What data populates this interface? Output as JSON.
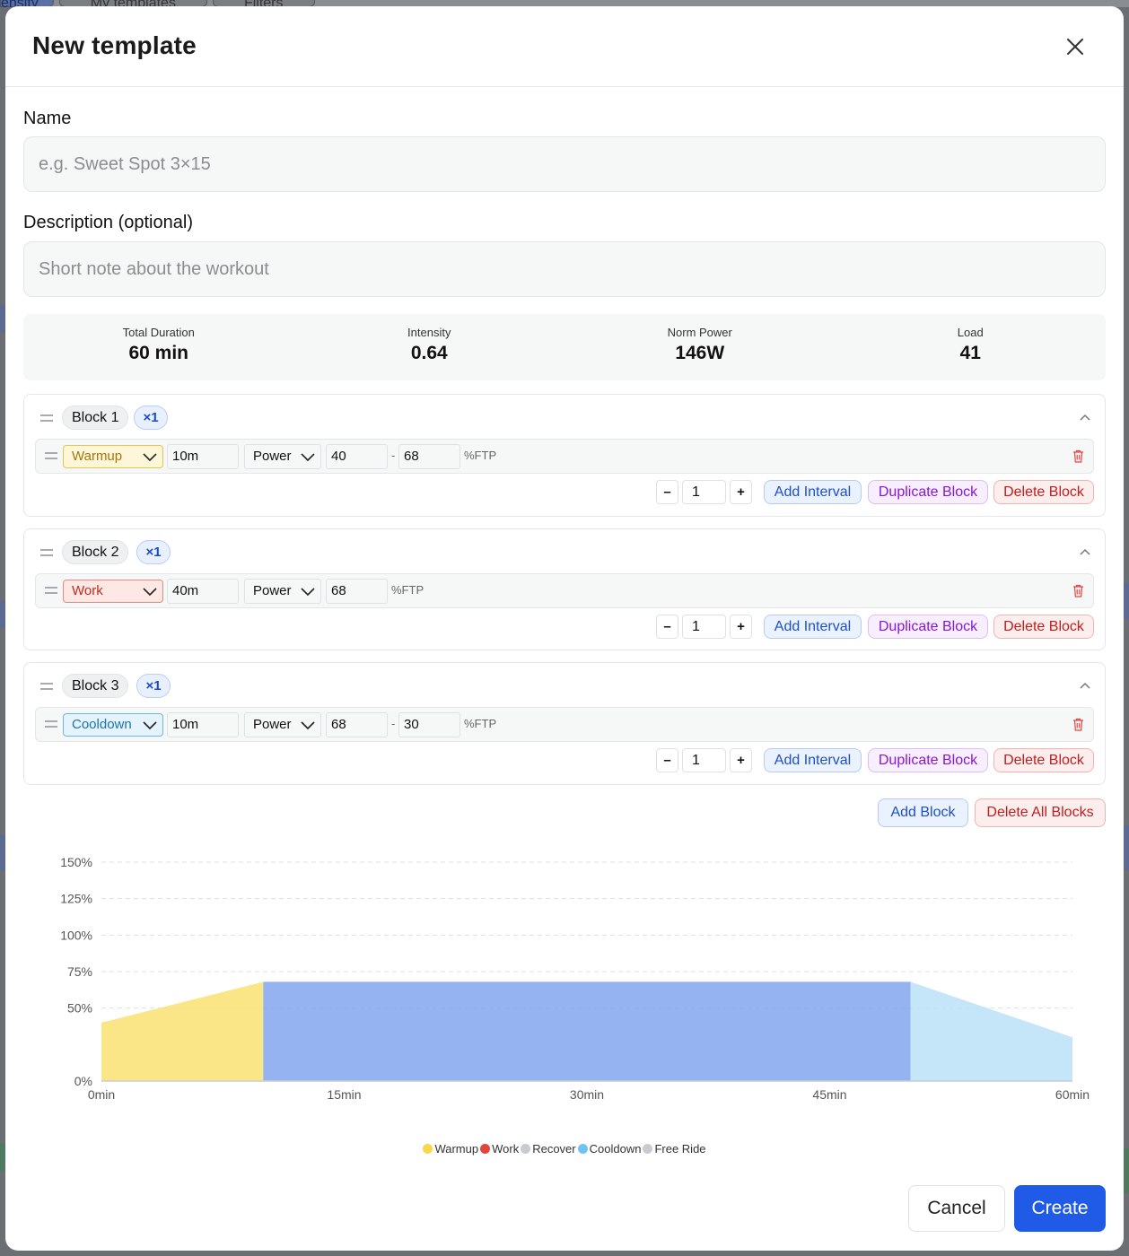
{
  "background": {
    "tabs": [
      "ensity",
      "My templates",
      "Filters"
    ]
  },
  "modal": {
    "title": "New template",
    "name_label": "Name",
    "name_placeholder": "e.g. Sweet Spot 3×15",
    "description_label": "Description (optional)",
    "description_placeholder": "Short note about the workout"
  },
  "stats": [
    {
      "label": "Total Duration",
      "value": "60 min"
    },
    {
      "label": "Intensity",
      "value": "0.64"
    },
    {
      "label": "Norm Power",
      "value": "146W"
    },
    {
      "label": "Load",
      "value": "41"
    }
  ],
  "blocks": [
    {
      "name": "Block 1",
      "repeat": "×1",
      "interval": {
        "type": "Warmup",
        "duration": "10m",
        "target": "Power",
        "from": "40",
        "to": "68",
        "unit": "%FTP"
      },
      "count": "1"
    },
    {
      "name": "Block 2",
      "repeat": "×1",
      "interval": {
        "type": "Work",
        "duration": "40m",
        "target": "Power",
        "from": "68",
        "unit": "%FTP"
      },
      "count": "1"
    },
    {
      "name": "Block 3",
      "repeat": "×1",
      "interval": {
        "type": "Cooldown",
        "duration": "10m",
        "target": "Power",
        "from": "68",
        "to": "30",
        "unit": "%FTP"
      },
      "count": "1"
    }
  ],
  "block_actions": {
    "minus": "–",
    "plus": "+",
    "range_dash": "-",
    "add_interval": "Add Interval",
    "duplicate_block": "Duplicate Block",
    "delete_block": "Delete Block"
  },
  "global_actions": {
    "add_block": "Add Block",
    "delete_all_blocks": "Delete All Blocks"
  },
  "chart_data": {
    "type": "area",
    "x_unit": "min",
    "xlim": [
      0,
      60
    ],
    "ylim": [
      0,
      150
    ],
    "yticks": [
      "0%",
      "50%",
      "75%",
      "100%",
      "125%",
      "150%"
    ],
    "ytick_values": [
      0,
      50,
      75,
      100,
      125,
      150
    ],
    "xticks": [
      "0min",
      "15min",
      "30min",
      "45min",
      "60min"
    ],
    "xtick_values": [
      0,
      15,
      30,
      45,
      60
    ],
    "grid": true,
    "segments": [
      {
        "type": "Warmup",
        "start": 0,
        "end": 10,
        "from": 40,
        "to": 68,
        "color": "#f9e27a"
      },
      {
        "type": "Work",
        "start": 10,
        "end": 50,
        "from": 68,
        "to": 68,
        "color": "#8aaaf0"
      },
      {
        "type": "Cooldown",
        "start": 50,
        "end": 60,
        "from": 68,
        "to": 30,
        "color": "#bfe2f8"
      }
    ],
    "legend": [
      {
        "name": "Warmup",
        "color": "#f7d84a"
      },
      {
        "name": "Work",
        "color": "#e2463a"
      },
      {
        "name": "Recover",
        "color": "#c8ccd1"
      },
      {
        "name": "Cooldown",
        "color": "#6ec3f2"
      },
      {
        "name": "Free Ride",
        "color": "#c8ccd1"
      }
    ]
  },
  "footer": {
    "cancel": "Cancel",
    "create": "Create"
  }
}
